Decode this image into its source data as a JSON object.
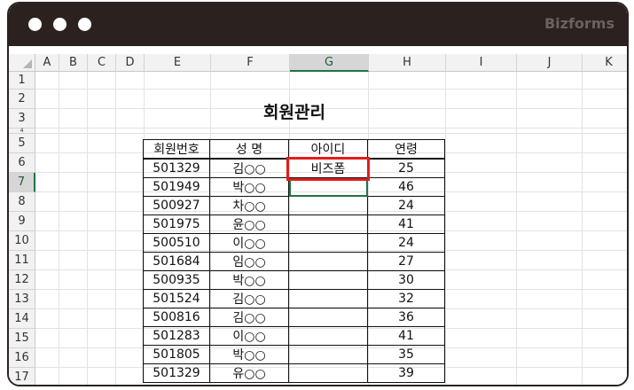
{
  "window": {
    "brand": "Bizforms"
  },
  "columns": [
    "A",
    "B",
    "C",
    "D",
    "E",
    "F",
    "G",
    "H",
    "I",
    "J",
    "K"
  ],
  "rows": [
    "1",
    "2",
    "3",
    "4",
    "5",
    "6",
    "7",
    "8",
    "9",
    "10",
    "11",
    "12",
    "13",
    "14",
    "15",
    "16",
    "17"
  ],
  "sheet_title": "회원관리",
  "table": {
    "headers": [
      "회원번호",
      "성  명",
      "아이디",
      "연령"
    ],
    "rows": [
      [
        "501329",
        "김○○",
        "비즈폼",
        "25"
      ],
      [
        "501949",
        "박○○",
        "",
        "46"
      ],
      [
        "500927",
        "차○○",
        "",
        "24"
      ],
      [
        "501975",
        "윤○○",
        "",
        "41"
      ],
      [
        "500510",
        "이○○",
        "",
        "24"
      ],
      [
        "501684",
        "임○○",
        "",
        "27"
      ],
      [
        "500935",
        "박○○",
        "",
        "30"
      ],
      [
        "501524",
        "김○○",
        "",
        "32"
      ],
      [
        "500816",
        "김○○",
        "",
        "36"
      ],
      [
        "501283",
        "이○○",
        "",
        "41"
      ],
      [
        "501805",
        "박○○",
        "",
        "35"
      ],
      [
        "501329",
        "유○○",
        "",
        "39"
      ]
    ]
  },
  "colors": {
    "titlebar": "#2b2220",
    "highlight": "#e01e1e",
    "selection": "#217346"
  }
}
